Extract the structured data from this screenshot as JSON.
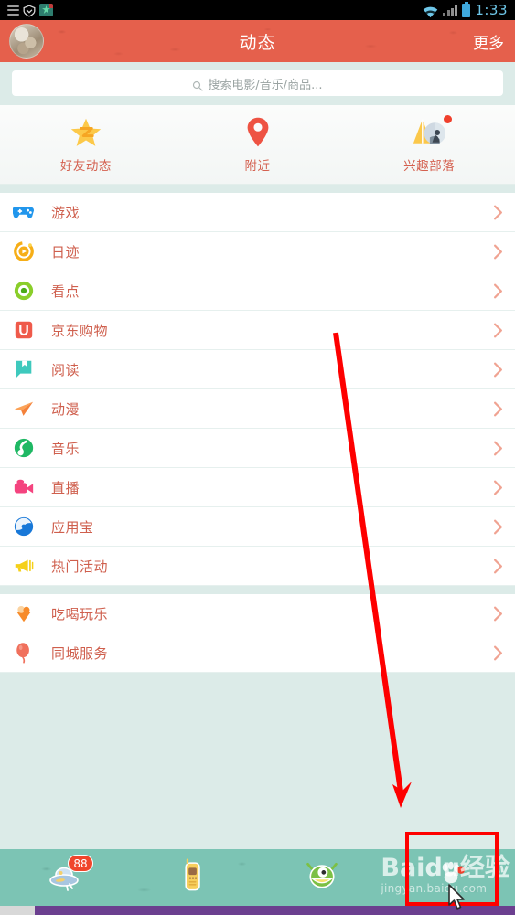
{
  "status_bar": {
    "time": "1:33",
    "left_icons": [
      "menu-icon",
      "shield-icon",
      "app-icon"
    ],
    "right_icons": [
      "wifi-icon",
      "signal-icon",
      "battery-icon"
    ],
    "background": "#000000",
    "time_color": "#6ec6e8"
  },
  "app_bar": {
    "title": "动态",
    "more_label": "更多",
    "avatar_name": "user-avatar",
    "background": "#e5604c"
  },
  "search": {
    "placeholder": "搜索电影/音乐/商品...",
    "icon": "search-icon",
    "value": ""
  },
  "quick_actions": [
    {
      "label": "好友动态",
      "icon": "star-qzone-icon",
      "badge": false
    },
    {
      "label": "附近",
      "icon": "location-pin-icon",
      "badge": false
    },
    {
      "label": "兴趣部落",
      "icon": "tribe-tent-icon",
      "badge": true
    }
  ],
  "list_group_1": [
    {
      "label": "游戏",
      "icon": "gamepad-icon",
      "chevron": "chevron-right-icon"
    },
    {
      "label": "日迹",
      "icon": "dayflow-icon",
      "chevron": "chevron-right-icon"
    },
    {
      "label": "看点",
      "icon": "kandian-eye-icon",
      "chevron": "chevron-right-icon"
    },
    {
      "label": "京东购物",
      "icon": "jd-bag-icon",
      "chevron": "chevron-right-icon"
    },
    {
      "label": "阅读",
      "icon": "book-icon",
      "chevron": "chevron-right-icon"
    },
    {
      "label": "动漫",
      "icon": "paper-plane-icon",
      "chevron": "chevron-right-icon"
    },
    {
      "label": "音乐",
      "icon": "music-note-icon",
      "chevron": "chevron-right-icon"
    },
    {
      "label": "直播",
      "icon": "video-camera-icon",
      "chevron": "chevron-right-icon"
    },
    {
      "label": "应用宝",
      "icon": "yingyongbao-icon",
      "chevron": "chevron-right-icon"
    },
    {
      "label": "热门活动",
      "icon": "megaphone-icon",
      "chevron": "chevron-right-icon"
    }
  ],
  "list_group_2": [
    {
      "label": "吃喝玩乐",
      "icon": "ice-cream-icon",
      "chevron": "chevron-right-icon"
    },
    {
      "label": "同城服务",
      "icon": "balloon-icon",
      "chevron": "chevron-right-icon"
    }
  ],
  "bottom_nav": [
    {
      "name": "ufo-icon",
      "badge": "88"
    },
    {
      "name": "phone-icon",
      "badge": ""
    },
    {
      "name": "monster-icon",
      "badge": ""
    },
    {
      "name": "paw-icon",
      "badge": ""
    }
  ],
  "watermark": {
    "main_a": "Bai",
    "main_b": "du",
    "main_c": "经验",
    "sub": "jingyan.baidu.com"
  },
  "annotations": {
    "arrow_color": "#fe0000",
    "highlight_color": "#fe0000",
    "arrow_from": "367,364",
    "arrow_to": "440,881"
  },
  "colors": {
    "accent": "#e5604c",
    "page_bg": "#dcebe8",
    "list_text": "#cf5f4d",
    "nav_bg": "#7cc4b4"
  }
}
